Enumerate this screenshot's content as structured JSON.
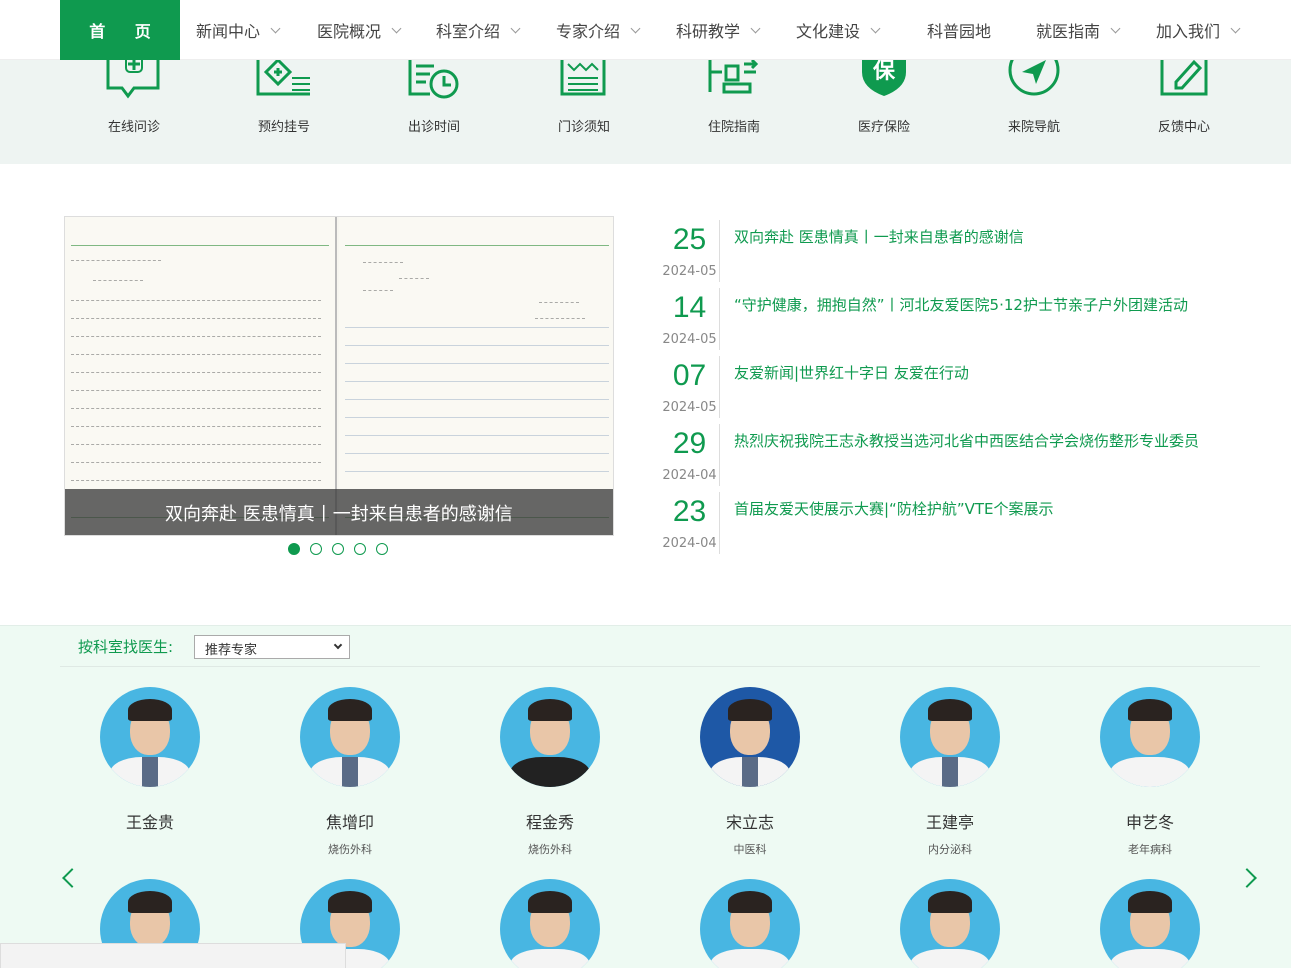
{
  "nav": {
    "home": "首 页",
    "items": [
      {
        "label": "新闻中心",
        "dropdown": true
      },
      {
        "label": "医院概况",
        "dropdown": true
      },
      {
        "label": "科室介绍",
        "dropdown": true
      },
      {
        "label": "专家介绍",
        "dropdown": true
      },
      {
        "label": "科研教学",
        "dropdown": true
      },
      {
        "label": "文化建设",
        "dropdown": true
      },
      {
        "label": "科普园地",
        "dropdown": false
      },
      {
        "label": "就医指南",
        "dropdown": true
      },
      {
        "label": "加入我们",
        "dropdown": true
      }
    ]
  },
  "quick_links": [
    {
      "label": "在线问诊",
      "icon": "online-consult-icon"
    },
    {
      "label": "预约挂号",
      "icon": "appointment-icon"
    },
    {
      "label": "出诊时间",
      "icon": "schedule-icon"
    },
    {
      "label": "门诊须知",
      "icon": "outpatient-notice-icon"
    },
    {
      "label": "住院指南",
      "icon": "inpatient-guide-icon"
    },
    {
      "label": "医疗保险",
      "icon": "insurance-icon"
    },
    {
      "label": "来院导航",
      "icon": "navigation-icon"
    },
    {
      "label": "反馈中心",
      "icon": "feedback-icon"
    }
  ],
  "slider": {
    "caption": "双向奔赴 医患情真丨一封来自患者的感谢信",
    "slide_count": 5,
    "active_index": 0
  },
  "news": [
    {
      "day": "25",
      "ym": "2024-05",
      "title": "双向奔赴 医患情真丨一封来自患者的感谢信"
    },
    {
      "day": "14",
      "ym": "2024-05",
      "title": "“守护健康，拥抱自然”丨河北友爱医院5·12护士节亲子户外团建活动"
    },
    {
      "day": "07",
      "ym": "2024-05",
      "title": "友爱新闻|世界红十字日 友爱在行动"
    },
    {
      "day": "29",
      "ym": "2024-04",
      "title": "热烈庆祝我院王志永教授当选河北省中西医结合学会烧伤整形专业委员"
    },
    {
      "day": "23",
      "ym": "2024-04",
      "title": "首届友爱天使展示大赛|“防栓护航”VTE个案展示"
    }
  ],
  "doctors": {
    "filter_label": "按科室找医生:",
    "select_value": "推荐专家",
    "row1": [
      {
        "name": "王金贵",
        "dept": ""
      },
      {
        "name": "焦增印",
        "dept": "烧伤外科"
      },
      {
        "name": "程金秀",
        "dept": "烧伤外科"
      },
      {
        "name": "宋立志",
        "dept": "中医科"
      },
      {
        "name": "王建亭",
        "dept": "内分泌科"
      },
      {
        "name": "申艺冬",
        "dept": "老年病科"
      }
    ],
    "row2_count": 6
  },
  "colors": {
    "brand_green": "#0f9a4f",
    "quick_band": "#eef4f2",
    "doctor_band": "#eefaf3",
    "avatar_blue": "#48b6e2"
  }
}
